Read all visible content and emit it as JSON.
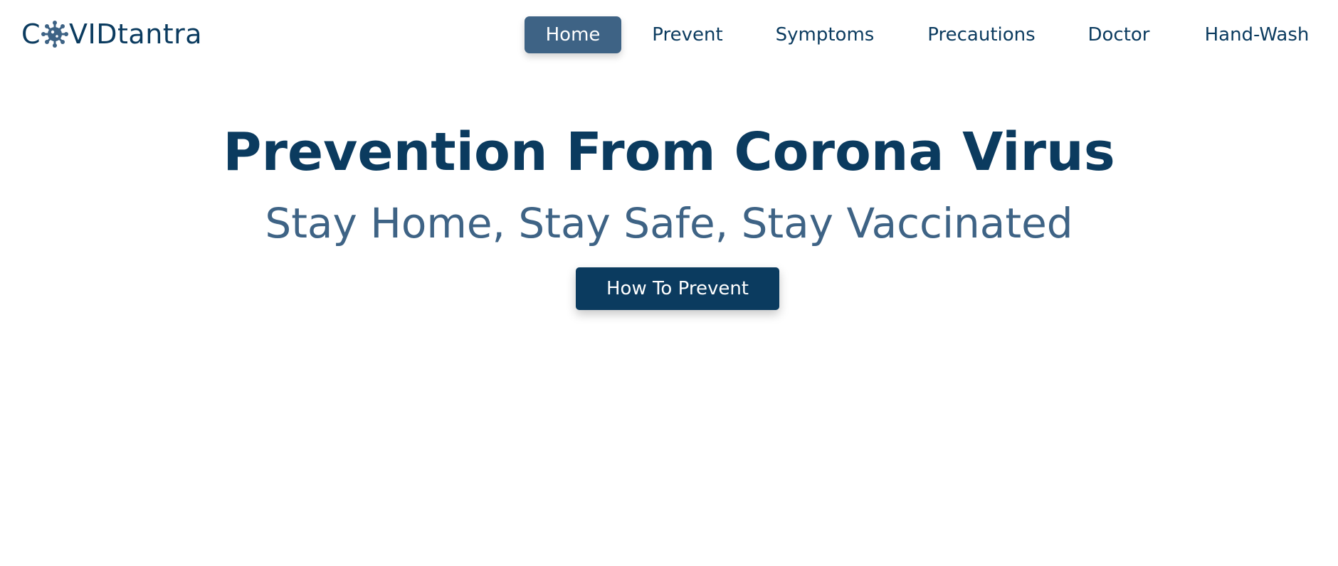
{
  "brand": {
    "prefix": "C",
    "suffix": "VIDtantra",
    "icon": "virus-icon",
    "color": "#0b3b5f"
  },
  "nav": {
    "items": [
      {
        "label": "Home",
        "active": true
      },
      {
        "label": "Prevent",
        "active": false
      },
      {
        "label": "Symptoms",
        "active": false
      },
      {
        "label": "Precautions",
        "active": false
      },
      {
        "label": "Doctor",
        "active": false
      },
      {
        "label": "Hand-Wash",
        "active": false
      }
    ],
    "active_color": "#3e6385"
  },
  "hero": {
    "title": "Prevention From Corona Virus",
    "subtitle": "Stay Home, Stay Safe, Stay Vaccinated",
    "cta_label": "How To Prevent",
    "cta_color": "#0b3b5f"
  }
}
